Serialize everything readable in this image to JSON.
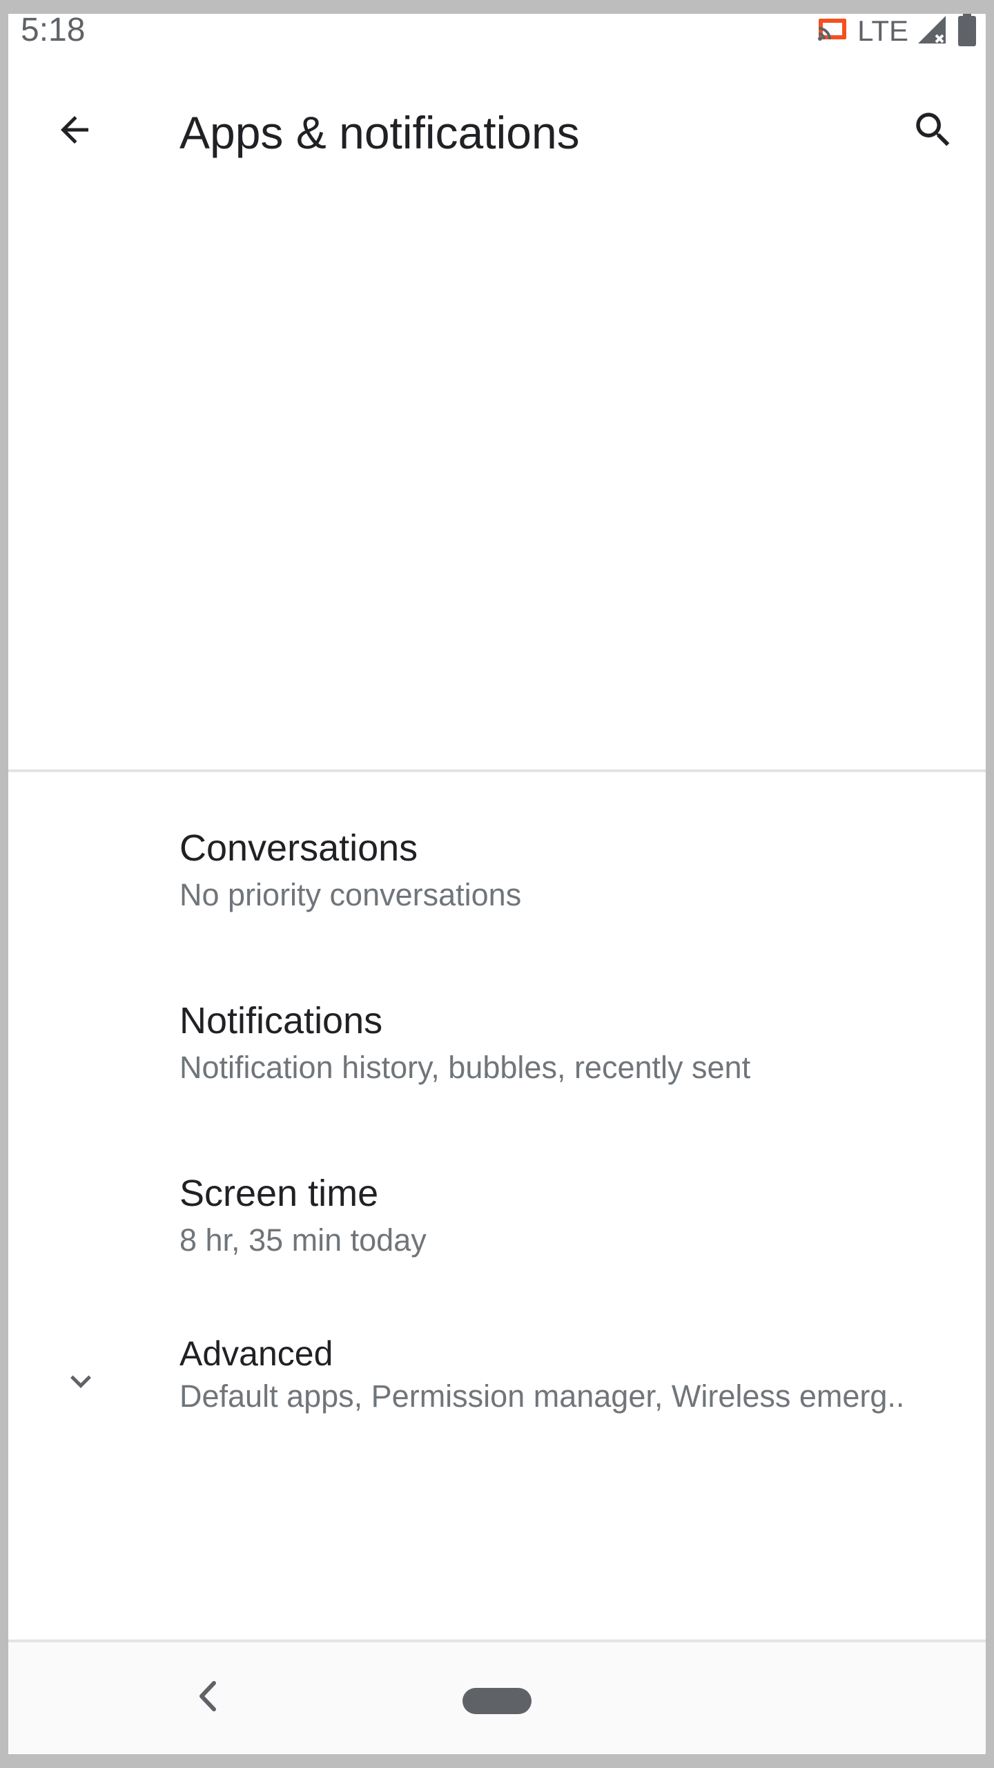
{
  "status_bar": {
    "time": "5:18",
    "network": "LTE",
    "icons": [
      "cast-icon",
      "signal-icon",
      "battery-icon"
    ]
  },
  "toolbar": {
    "title": "Apps & notifications",
    "back_icon": "arrow-back-icon",
    "search_icon": "search-icon"
  },
  "preferences": [
    {
      "title": "Conversations",
      "summary": "No priority conversations"
    },
    {
      "title": "Notifications",
      "summary": "Notification history, bubbles, recently sent"
    },
    {
      "title": "Screen time",
      "summary": "8 hr, 35 min today"
    },
    {
      "title": "Advanced",
      "summary": "Default apps, Permission manager, Wireless emerg..",
      "icon": "chevron-down-icon"
    }
  ],
  "nav_bar": {
    "back_icon": "nav-back-icon",
    "home_icon": "home-pill-icon"
  },
  "colors": {
    "accent_cast": "#f4511e",
    "text_primary": "#202124",
    "text_secondary": "#70757a"
  }
}
